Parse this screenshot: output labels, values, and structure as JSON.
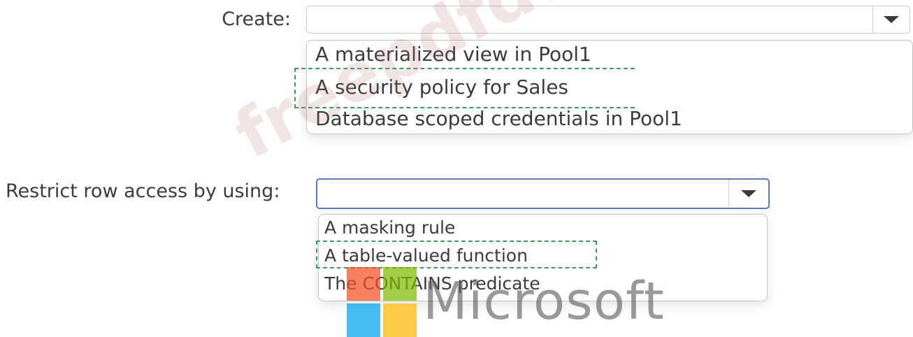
{
  "question1": {
    "label": "Create:",
    "selected_value": "",
    "options": [
      "A materialized view in Pool1",
      "A security policy for Sales",
      "Database scoped credentials in Pool1"
    ],
    "marked_option": "A security policy for Sales"
  },
  "question2": {
    "label": "Restrict row access by using:",
    "selected_value": "",
    "options": [
      "A masking rule",
      "A table-valued function",
      "The CONTAINS predicate"
    ],
    "marked_option": "A table-valued function"
  },
  "watermark": {
    "text": "freepdfdumps.com"
  },
  "logo": {
    "text": "Microsoft",
    "colors": [
      "#f25022",
      "#7fba00",
      "#00a4ef",
      "#ffb900"
    ]
  },
  "icons": {
    "dropdown": "chevron-down-icon"
  },
  "colors": {
    "focus_border": "#5a78c8",
    "answer_marker": "#3f9b5c"
  }
}
